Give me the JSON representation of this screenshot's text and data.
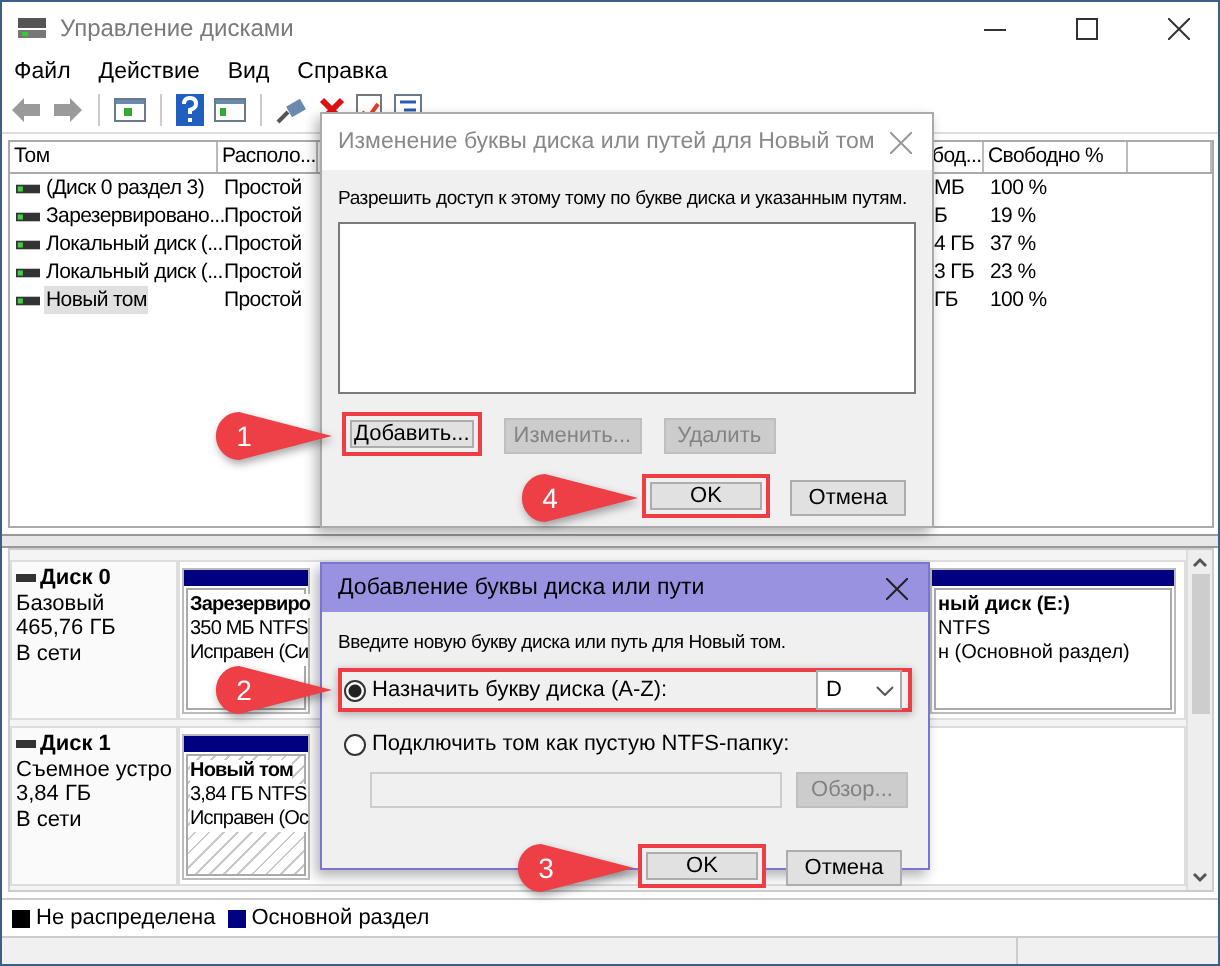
{
  "window": {
    "title": "Управление дисками"
  },
  "menu": [
    "Файл",
    "Действие",
    "Вид",
    "Справка"
  ],
  "volumes": {
    "columns": [
      "Том",
      "Располо...",
      "бод...",
      "Свободно %"
    ],
    "rows": [
      {
        "cells": [
          "(Диск 0 раздел 3)",
          "Простой",
          "МБ",
          "100 %"
        ],
        "selected": false
      },
      {
        "cells": [
          "Зарезервировано...",
          "Простой",
          "Б",
          "19 %"
        ],
        "selected": false
      },
      {
        "cells": [
          "Локальный диск (...",
          "Простой",
          "4 ГБ",
          "37 %"
        ],
        "selected": false
      },
      {
        "cells": [
          "Локальный диск (...",
          "Простой",
          "3 ГБ",
          "23 %"
        ],
        "selected": false
      },
      {
        "cells": [
          "Новый том",
          "Простой",
          "ГБ",
          "100 %"
        ],
        "selected": true
      }
    ]
  },
  "disks": [
    {
      "name": "Диск 0",
      "type": "Базовый",
      "size": "465,76 ГБ",
      "status": "В сети",
      "partitions": [
        {
          "lines": [
            "Зарезервиро",
            "350 МБ NTFS",
            "Исправен (Си"
          ],
          "selected": false
        },
        {
          "lines": [
            "ный диск  (E:)",
            "NTFS",
            "н (Основной раздел)"
          ],
          "selected": false
        }
      ]
    },
    {
      "name": "Диск 1",
      "type": "Съемное устро",
      "size": "3,84 ГБ",
      "status": "В сети",
      "partitions": [
        {
          "lines": [
            "Новый том",
            "3,84 ГБ NTFS",
            "Исправен (Ос"
          ],
          "selected": true
        }
      ]
    }
  ],
  "legend": [
    {
      "label": "Не распределена",
      "color": "#000000"
    },
    {
      "label": "Основной раздел",
      "color": "#000080"
    }
  ],
  "change_dialog": {
    "title": "Изменение буквы диска или путей для Новый том",
    "active": false,
    "prompt": "Разрешить доступ к этому тому по букве диска и указанным путям.",
    "buttons": [
      {
        "label": "Добавить...",
        "disabled": false,
        "highlighted": true,
        "callout": "1"
      },
      {
        "label": "Изменить...",
        "disabled": true,
        "highlighted": false
      },
      {
        "label": "Удалить",
        "disabled": true,
        "highlighted": false
      }
    ],
    "footer": [
      {
        "label": "OK",
        "highlighted": true,
        "callout": "4"
      },
      {
        "label": "Отмена",
        "highlighted": false
      }
    ]
  },
  "add_dialog": {
    "title": "Добавление буквы диска или пути",
    "active": true,
    "prompt": "Введите новую букву диска или путь для Новый том.",
    "options": [
      {
        "kind": "letter",
        "label": "Назначить букву диска (A-Z):",
        "selected": true,
        "highlighted": true,
        "callout": "2",
        "value": "D"
      },
      {
        "kind": "folder",
        "label": "Подключить том как пустую NTFS-папку:",
        "selected": false,
        "highlighted": false,
        "browse": "Обзор..."
      }
    ],
    "footer": [
      {
        "label": "OK",
        "highlighted": true,
        "callout": "3"
      },
      {
        "label": "Отмена",
        "highlighted": false
      }
    ]
  }
}
